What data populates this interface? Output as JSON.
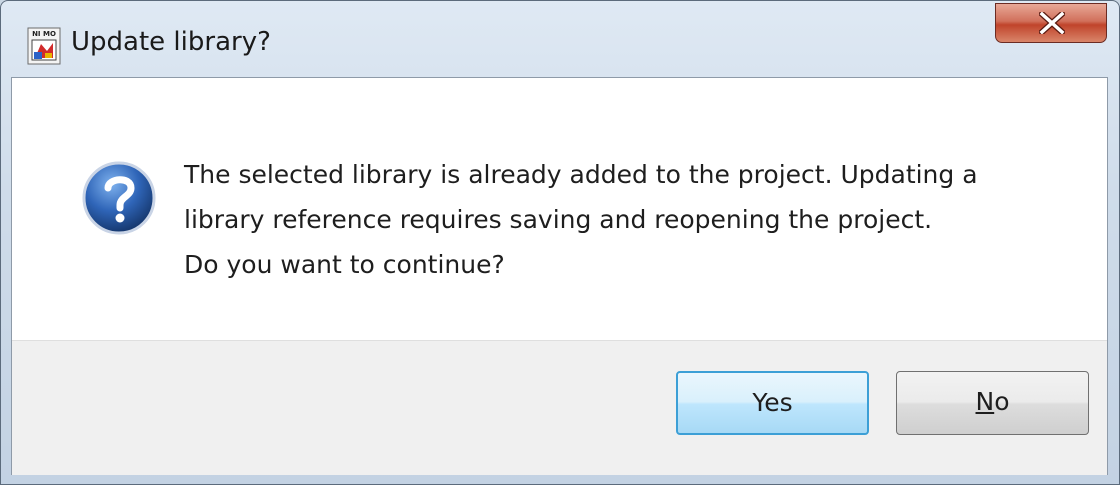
{
  "window": {
    "title": "Update library?",
    "app_icon_text": "NI MO"
  },
  "dialog": {
    "icon": "question-icon",
    "message_lines": [
      "The selected library is already added to the project. Updating a",
      "library reference requires saving and reopening the project.",
      "Do you want to continue?"
    ]
  },
  "buttons": {
    "yes_label": "Yes",
    "no_mnemonic": "N",
    "no_rest": "o"
  },
  "colors": {
    "close_button": "#c0442b",
    "default_button_border": "#3c9fd6",
    "question_icon": "#2b5fae"
  }
}
